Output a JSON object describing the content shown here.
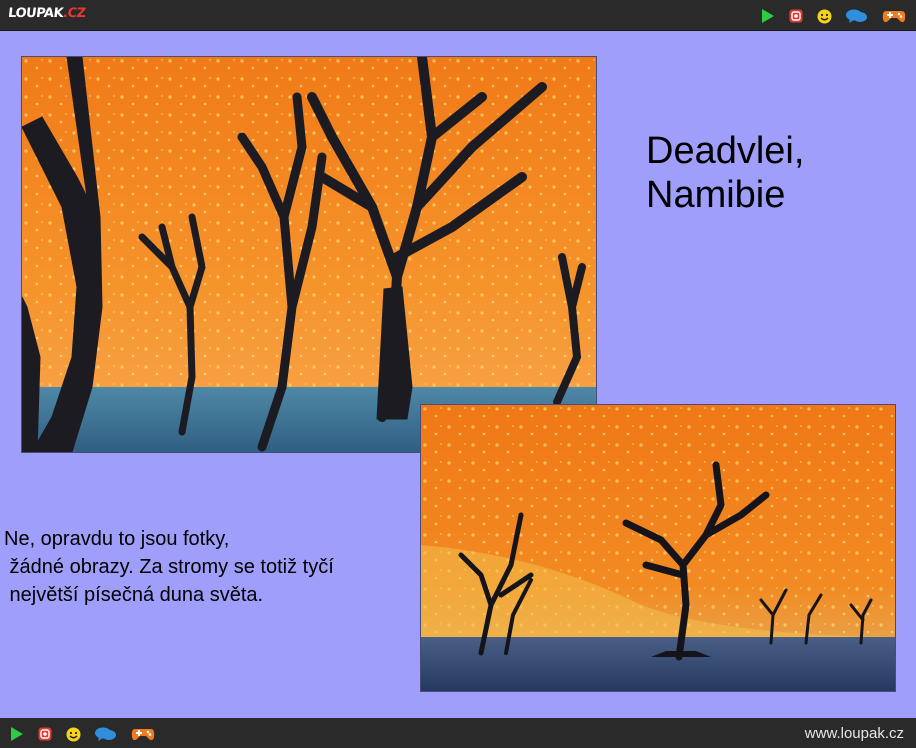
{
  "logo": {
    "main": "LOUPAK",
    "suffix": ".CZ"
  },
  "toolbar_icons": [
    "play-icon",
    "instagram-icon",
    "smiley-icon",
    "chat-icon",
    "gamepad-icon"
  ],
  "colors": {
    "bar": "#2a2a2a",
    "content_bg": "#9f9ffb",
    "play": "#2ecc40",
    "instagram": "#e53935",
    "smiley": "#f7d31a",
    "chat": "#2f8fdd",
    "gamepad": "#f07a1e"
  },
  "title": {
    "line1": "Deadvlei,",
    "line2": "Namibie"
  },
  "caption": {
    "line1": "Ne, opravdu to jsou fotky,",
    "line2": " žádné obrazy. Za stromy se totiž tyčí",
    "line3": " největší písečná duna světa."
  },
  "footer": {
    "url": "www.loupak.cz"
  }
}
